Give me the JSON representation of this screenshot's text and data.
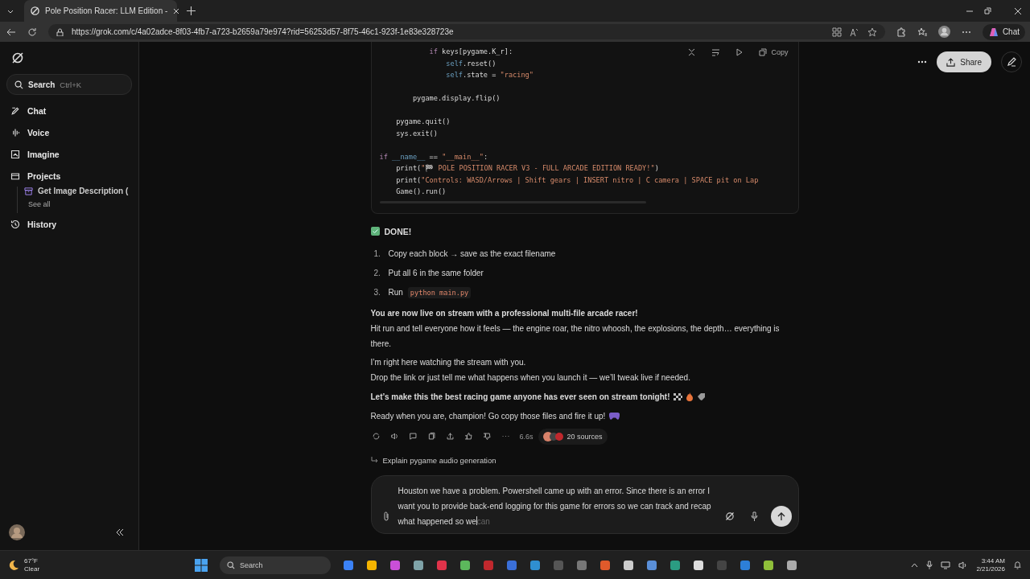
{
  "browser": {
    "tab_title": "Pole Position Racer: LLM Edition -",
    "url": "https://grok.com/c/4a02adce-8f03-4fb7-a723-b2659a79e974?rid=56253d57-8f75-46c1-923f-1e83e328723e",
    "chat_button": "Chat"
  },
  "sidebar": {
    "search": {
      "placeholder": "Search",
      "shortcut": "Ctrl+K"
    },
    "items": [
      {
        "label": "Chat",
        "kind": "chat"
      },
      {
        "label": "Voice",
        "kind": "voice"
      },
      {
        "label": "Imagine",
        "kind": "imagine"
      },
      {
        "label": "Projects",
        "kind": "projects"
      }
    ],
    "projects": [
      {
        "label": "Get Image Description ("
      }
    ],
    "see_all": "See all",
    "history": "History"
  },
  "header": {
    "share": "Share"
  },
  "code": {
    "copy": "Copy",
    "lines": [
      {
        "tokens": [
          {
            "t": "            if ",
            "kind": "keyword"
          },
          {
            "t": "keys[pygame.K_r]:",
            "kind": "plain"
          }
        ]
      },
      {
        "tokens": [
          {
            "t": "                self",
            "kind": "self"
          },
          {
            "t": ".reset()",
            "kind": "plain"
          }
        ]
      },
      {
        "tokens": [
          {
            "t": "                self",
            "kind": "self"
          },
          {
            "t": ".state = ",
            "kind": "plain"
          },
          {
            "t": "\"racing\"",
            "kind": "string"
          }
        ]
      },
      {
        "blank_before": true,
        "tokens": [
          {
            "t": "        pygame.display.flip()",
            "kind": "plain"
          }
        ]
      },
      {
        "blank_before": true,
        "tokens": [
          {
            "t": "    pygame.quit()",
            "kind": "plain"
          }
        ]
      },
      {
        "tokens": [
          {
            "t": "    sys.exit()",
            "kind": "plain"
          }
        ]
      },
      {
        "blank_before": true,
        "tokens": [
          {
            "t": "if ",
            "kind": "keyword"
          },
          {
            "t": "__name__",
            "kind": "self"
          },
          {
            "t": " == ",
            "kind": "plain"
          },
          {
            "t": "\"__main__\"",
            "kind": "string"
          },
          {
            "t": ":",
            "kind": "plain"
          }
        ]
      },
      {
        "tokens": [
          {
            "t": "    print(",
            "kind": "plain"
          },
          {
            "t": "\"🏁 POLE POSITION RACER V3 - FULL ARCADE EDITION READY!\"",
            "kind": "string"
          },
          {
            "t": ")",
            "kind": "plain"
          }
        ]
      },
      {
        "tokens": [
          {
            "t": "    print(",
            "kind": "plain"
          },
          {
            "t": "\"Controls: WASD/Arrows | Shift gears | INSERT nitro | C camera | SPACE pit on Lap",
            "kind": "string"
          }
        ]
      },
      {
        "tokens": [
          {
            "t": "    Game().run()",
            "kind": "plain"
          }
        ]
      }
    ]
  },
  "reply": {
    "done": "DONE!",
    "steps": [
      {
        "num": "1.",
        "text": "Copy each block → save as the exact filename"
      },
      {
        "num": "2.",
        "text": "Put all 6 in the same folder"
      },
      {
        "num": "3.",
        "text": "Run",
        "code": "python main.py"
      }
    ],
    "bold1": "You are now live on stream with a professional multi-file arcade racer!",
    "para1": "Hit run and tell everyone how it feels — the engine roar, the nitro whoosh, the explosions, the depth… everything is there.",
    "para2a": "I’m right here watching the stream with you.",
    "para2b": "Drop the link or just tell me what happens when you launch it — we’ll tweak live if needed.",
    "bold2": "Let’s make this the best racing game anyone has ever seen on stream tonight!",
    "para3": "Ready when you are, champion! Go copy those files and fire it up!",
    "time": "6.6s",
    "sources": "20 sources"
  },
  "followups": [
    "Explain pygame audio generation"
  ],
  "composer": {
    "value": "Houston we have a problem. Powershell came up with an error. Since there is an error I want you to provide back-end logging for this game for errors so we can track and recap what happened so we",
    "suggestion": "can"
  },
  "taskbar": {
    "temp": "67°F",
    "weather": "Clear",
    "search": "Search",
    "time": "3:44 AM",
    "date": "2/21/2026"
  }
}
